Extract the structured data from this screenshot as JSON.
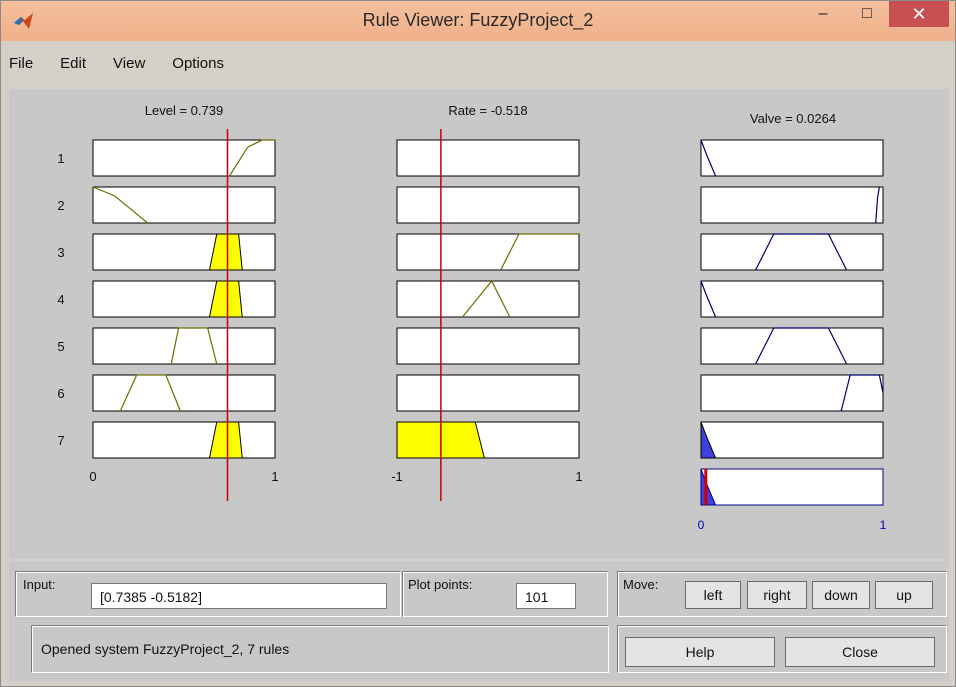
{
  "window": {
    "title": "Rule Viewer: FuzzyProject_2",
    "minimize_symbol": "–",
    "maximize_symbol": "□",
    "close_symbol": "✕"
  },
  "menu": [
    "File",
    "Edit",
    "View",
    "Options"
  ],
  "headers": {
    "level": "Level = 0.739",
    "rate": "Rate = -0.518",
    "valve": "Valve = 0.0264"
  },
  "rule_numbers": [
    "1",
    "2",
    "3",
    "4",
    "5",
    "6",
    "7"
  ],
  "axes": {
    "level": {
      "min_label": "0",
      "max_label": "1",
      "min": 0,
      "max": 1,
      "marker": 0.739
    },
    "rate": {
      "min_label": "-1",
      "max_label": "1",
      "min": -1,
      "max": 1,
      "marker": -0.518
    },
    "valve": {
      "min_label": "0",
      "max_label": "1",
      "min": 0,
      "max": 1,
      "marker": 0.0264
    }
  },
  "colors": {
    "input_mf": "#6e6e00",
    "fill": "#ffff00",
    "output_mf": "#00006e",
    "output_fill": "#4040e0",
    "marker": "#cc0000",
    "axis_label_blue": "#0000aa"
  },
  "controls": {
    "input_label": "Input:",
    "input_value": "[0.7385 -0.5182]",
    "plot_points_label": "Plot points:",
    "plot_points_value": "101",
    "move_label": "Move:",
    "move_buttons": [
      "left",
      "right",
      "down",
      "up"
    ],
    "status_text": "Opened system FuzzyProject_2, 7 rules",
    "help_label": "Help",
    "close_label": "Close"
  }
}
